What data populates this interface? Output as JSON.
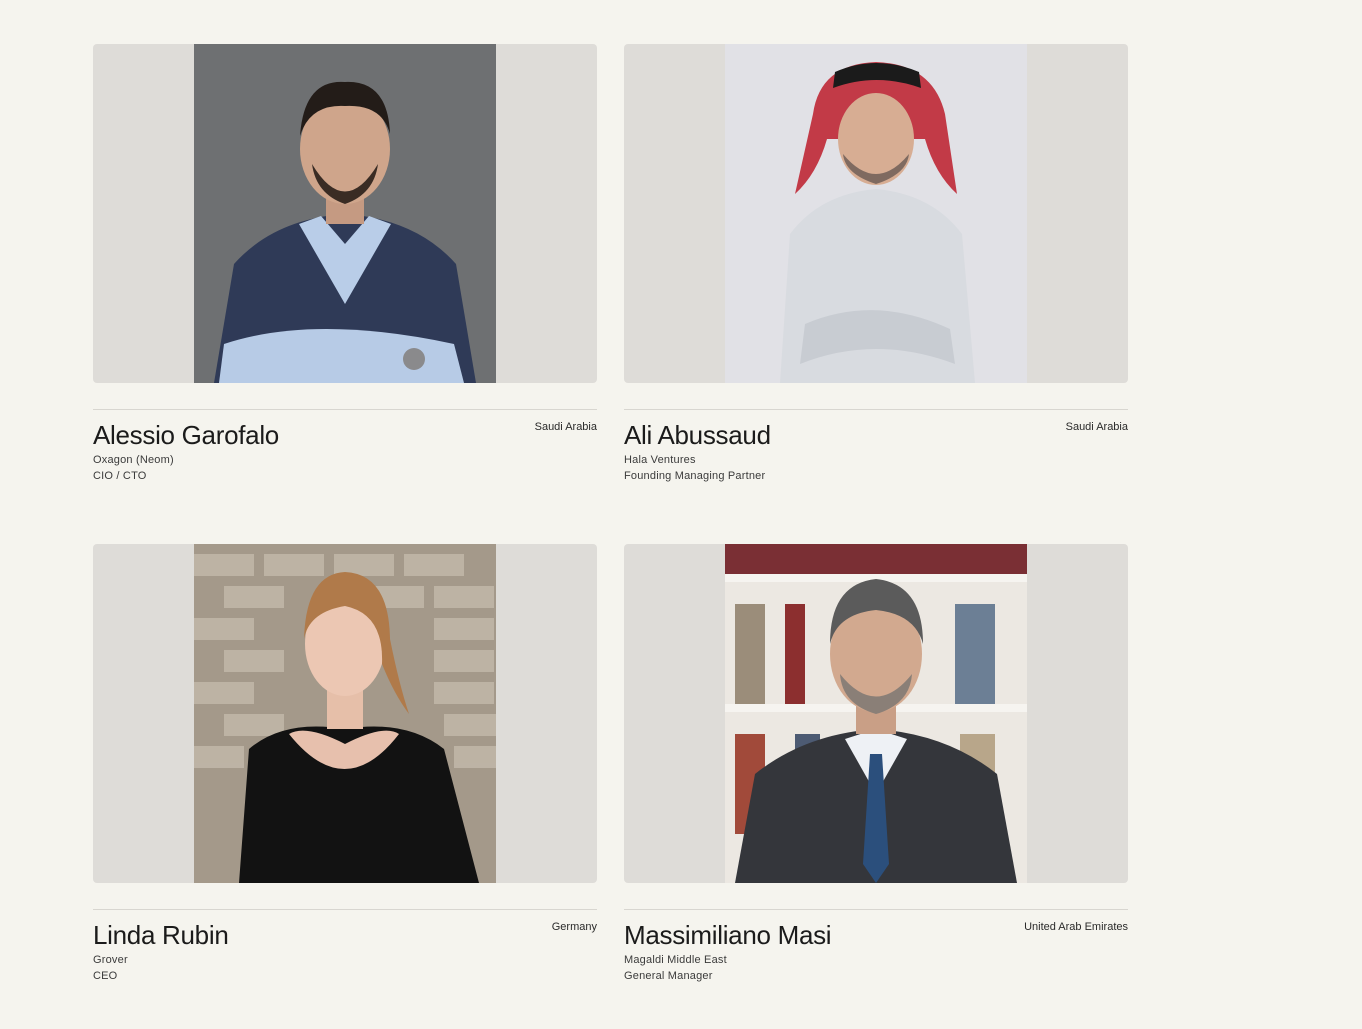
{
  "people": [
    {
      "name": "Alessio Garofalo",
      "company": "Oxagon (Neom)",
      "role": "CIO / CTO",
      "country": "Saudi Arabia",
      "photo_bg": "#6f7173"
    },
    {
      "name": "Ali Abussaud",
      "company": "Hala Ventures",
      "role": "Founding Managing Partner",
      "country": "Saudi Arabia",
      "photo_bg": "#e2e2e6"
    },
    {
      "name": "Linda Rubin",
      "company": "Grover",
      "role": "CEO",
      "country": "Germany",
      "photo_bg": "#a59a8a"
    },
    {
      "name": "Massimiliano Masi",
      "company": "Magaldi Middle East",
      "role": "General Manager",
      "country": "United Arab Emirates",
      "photo_bg": "#e9e5de"
    }
  ]
}
